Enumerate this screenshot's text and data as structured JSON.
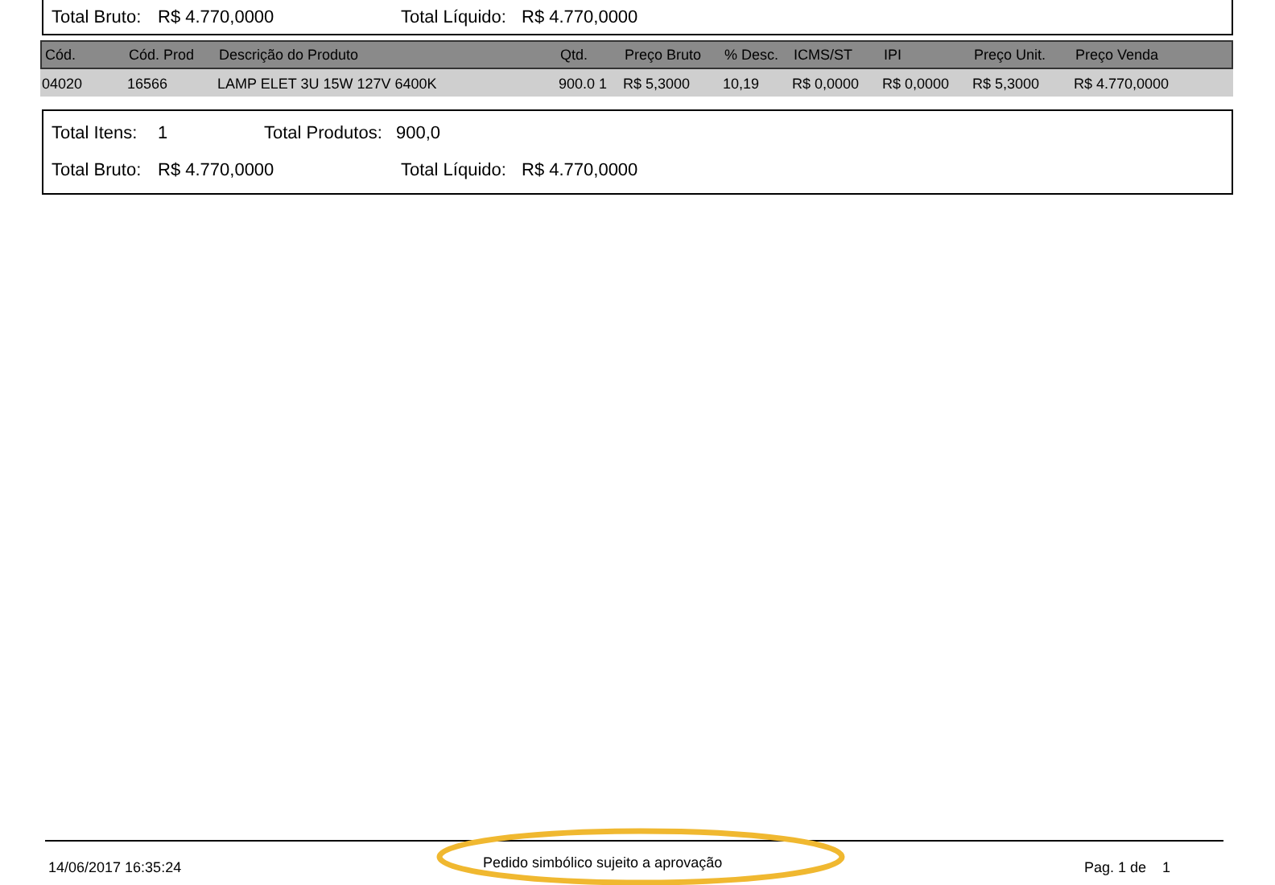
{
  "top_summary": {
    "fields": [
      {
        "label": "Total Bruto:",
        "value": "R$ 4.770,0000"
      },
      {
        "label": "Total Líquido:",
        "value": "R$ 4.770,0000"
      }
    ]
  },
  "table": {
    "columns": [
      "Cód.",
      "Cód. Prod",
      "Descrição do Produto",
      "Qtd.",
      "Preço Bruto",
      "% Desc.",
      "ICMS/ST",
      "IPI",
      "Preço Unit.",
      "Preço Venda"
    ],
    "rows": [
      [
        "04020",
        "16566",
        "LAMP ELET 3U 15W 127V 6400K",
        "900.0 1",
        "R$ 5,3000",
        "10,19",
        "R$ 0,0000",
        "R$ 0,0000",
        "R$ 5,3000",
        "R$ 4.770,0000"
      ]
    ]
  },
  "summary": {
    "rows": [
      [
        {
          "label": "Total Itens:",
          "value": "1"
        },
        {
          "label": "Total Produtos:",
          "value": "900,0"
        }
      ],
      [
        {
          "label": "Total Bruto:",
          "value": "R$ 4.770,0000"
        },
        {
          "label": "Total Líquido:",
          "value": "R$ 4.770,0000"
        }
      ]
    ]
  },
  "footer": {
    "timestamp": "14/06/2017 16:35:24",
    "note": "Pedido simbólico sujeito a aprovação",
    "note_highlighted": true,
    "page_label": "Pag. 1 de",
    "page_total": "1"
  }
}
